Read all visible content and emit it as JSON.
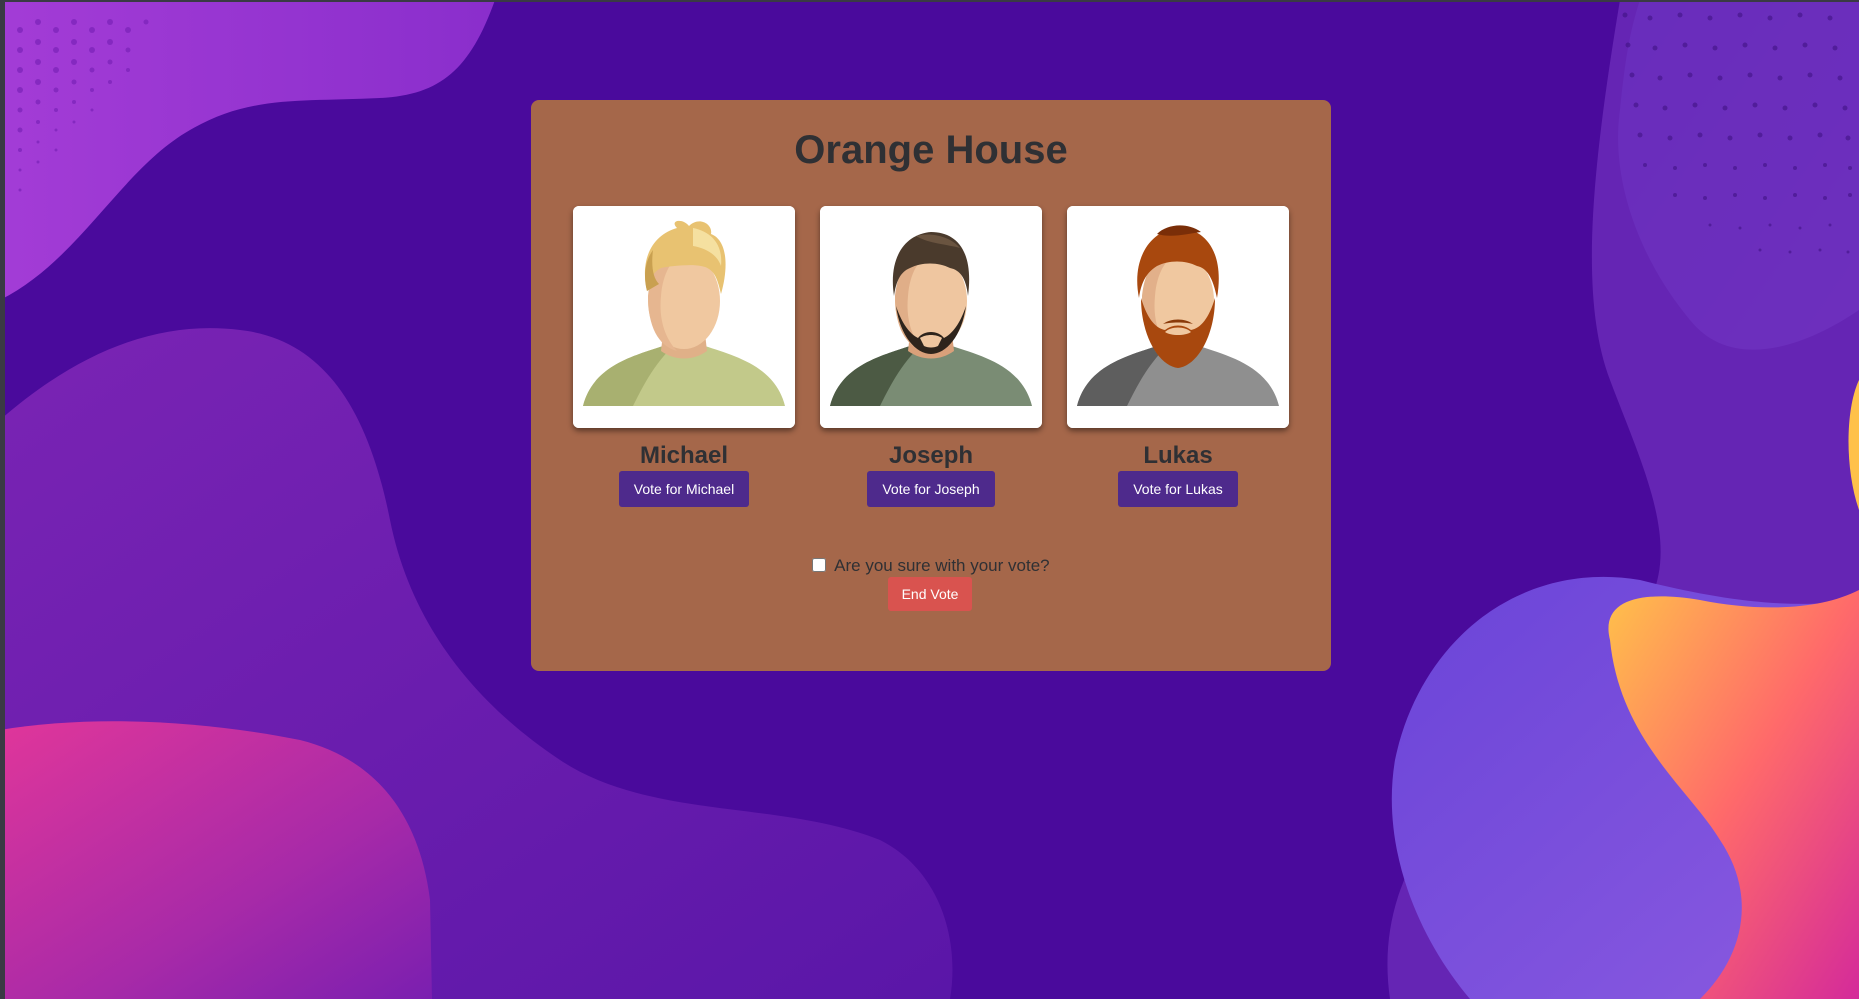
{
  "page": {
    "title": "Orange House"
  },
  "candidates": [
    {
      "name": "Michael",
      "vote_label": "Vote for Michael",
      "hair_color": "#e8c271",
      "shirt_color": "#c2c98a"
    },
    {
      "name": "Joseph",
      "vote_label": "Vote for Joseph",
      "hair_color": "#4a3a2c",
      "shirt_color": "#7a8c74"
    },
    {
      "name": "Lukas",
      "vote_label": "Vote for Lukas",
      "hair_color": "#a8480e",
      "shirt_color": "#8f8f8f"
    }
  ],
  "confirm": {
    "label": "Are you sure with your vote?",
    "checked": false
  },
  "end_vote": {
    "label": "End Vote"
  },
  "colors": {
    "panel": "#a5674a",
    "vote_button": "#4e2a8c",
    "end_button": "#d9534f",
    "background": "#4a0a9c"
  }
}
